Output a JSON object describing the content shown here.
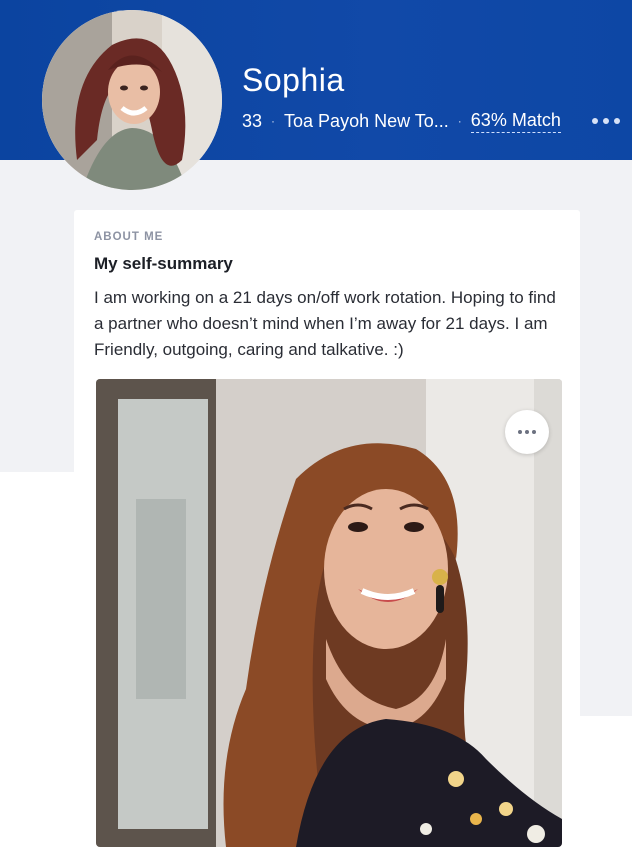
{
  "profile": {
    "name": "Sophia",
    "age": "33",
    "location": "Toa Payoh New To...",
    "match": "63% Match",
    "separator": "·"
  },
  "header": {
    "more_icon": "ellipsis-icon",
    "color": "#0e47a1"
  },
  "about": {
    "section_label": "ABOUT ME",
    "title": "My self-summary",
    "text": "I am working on a 21 days on/off work rotation. Hoping to find a partner who doesn’t mind when I’m away for 21 days. I am Friendly, outgoing, caring and talkative. :)"
  },
  "photo": {
    "more_icon": "ellipsis-icon"
  }
}
